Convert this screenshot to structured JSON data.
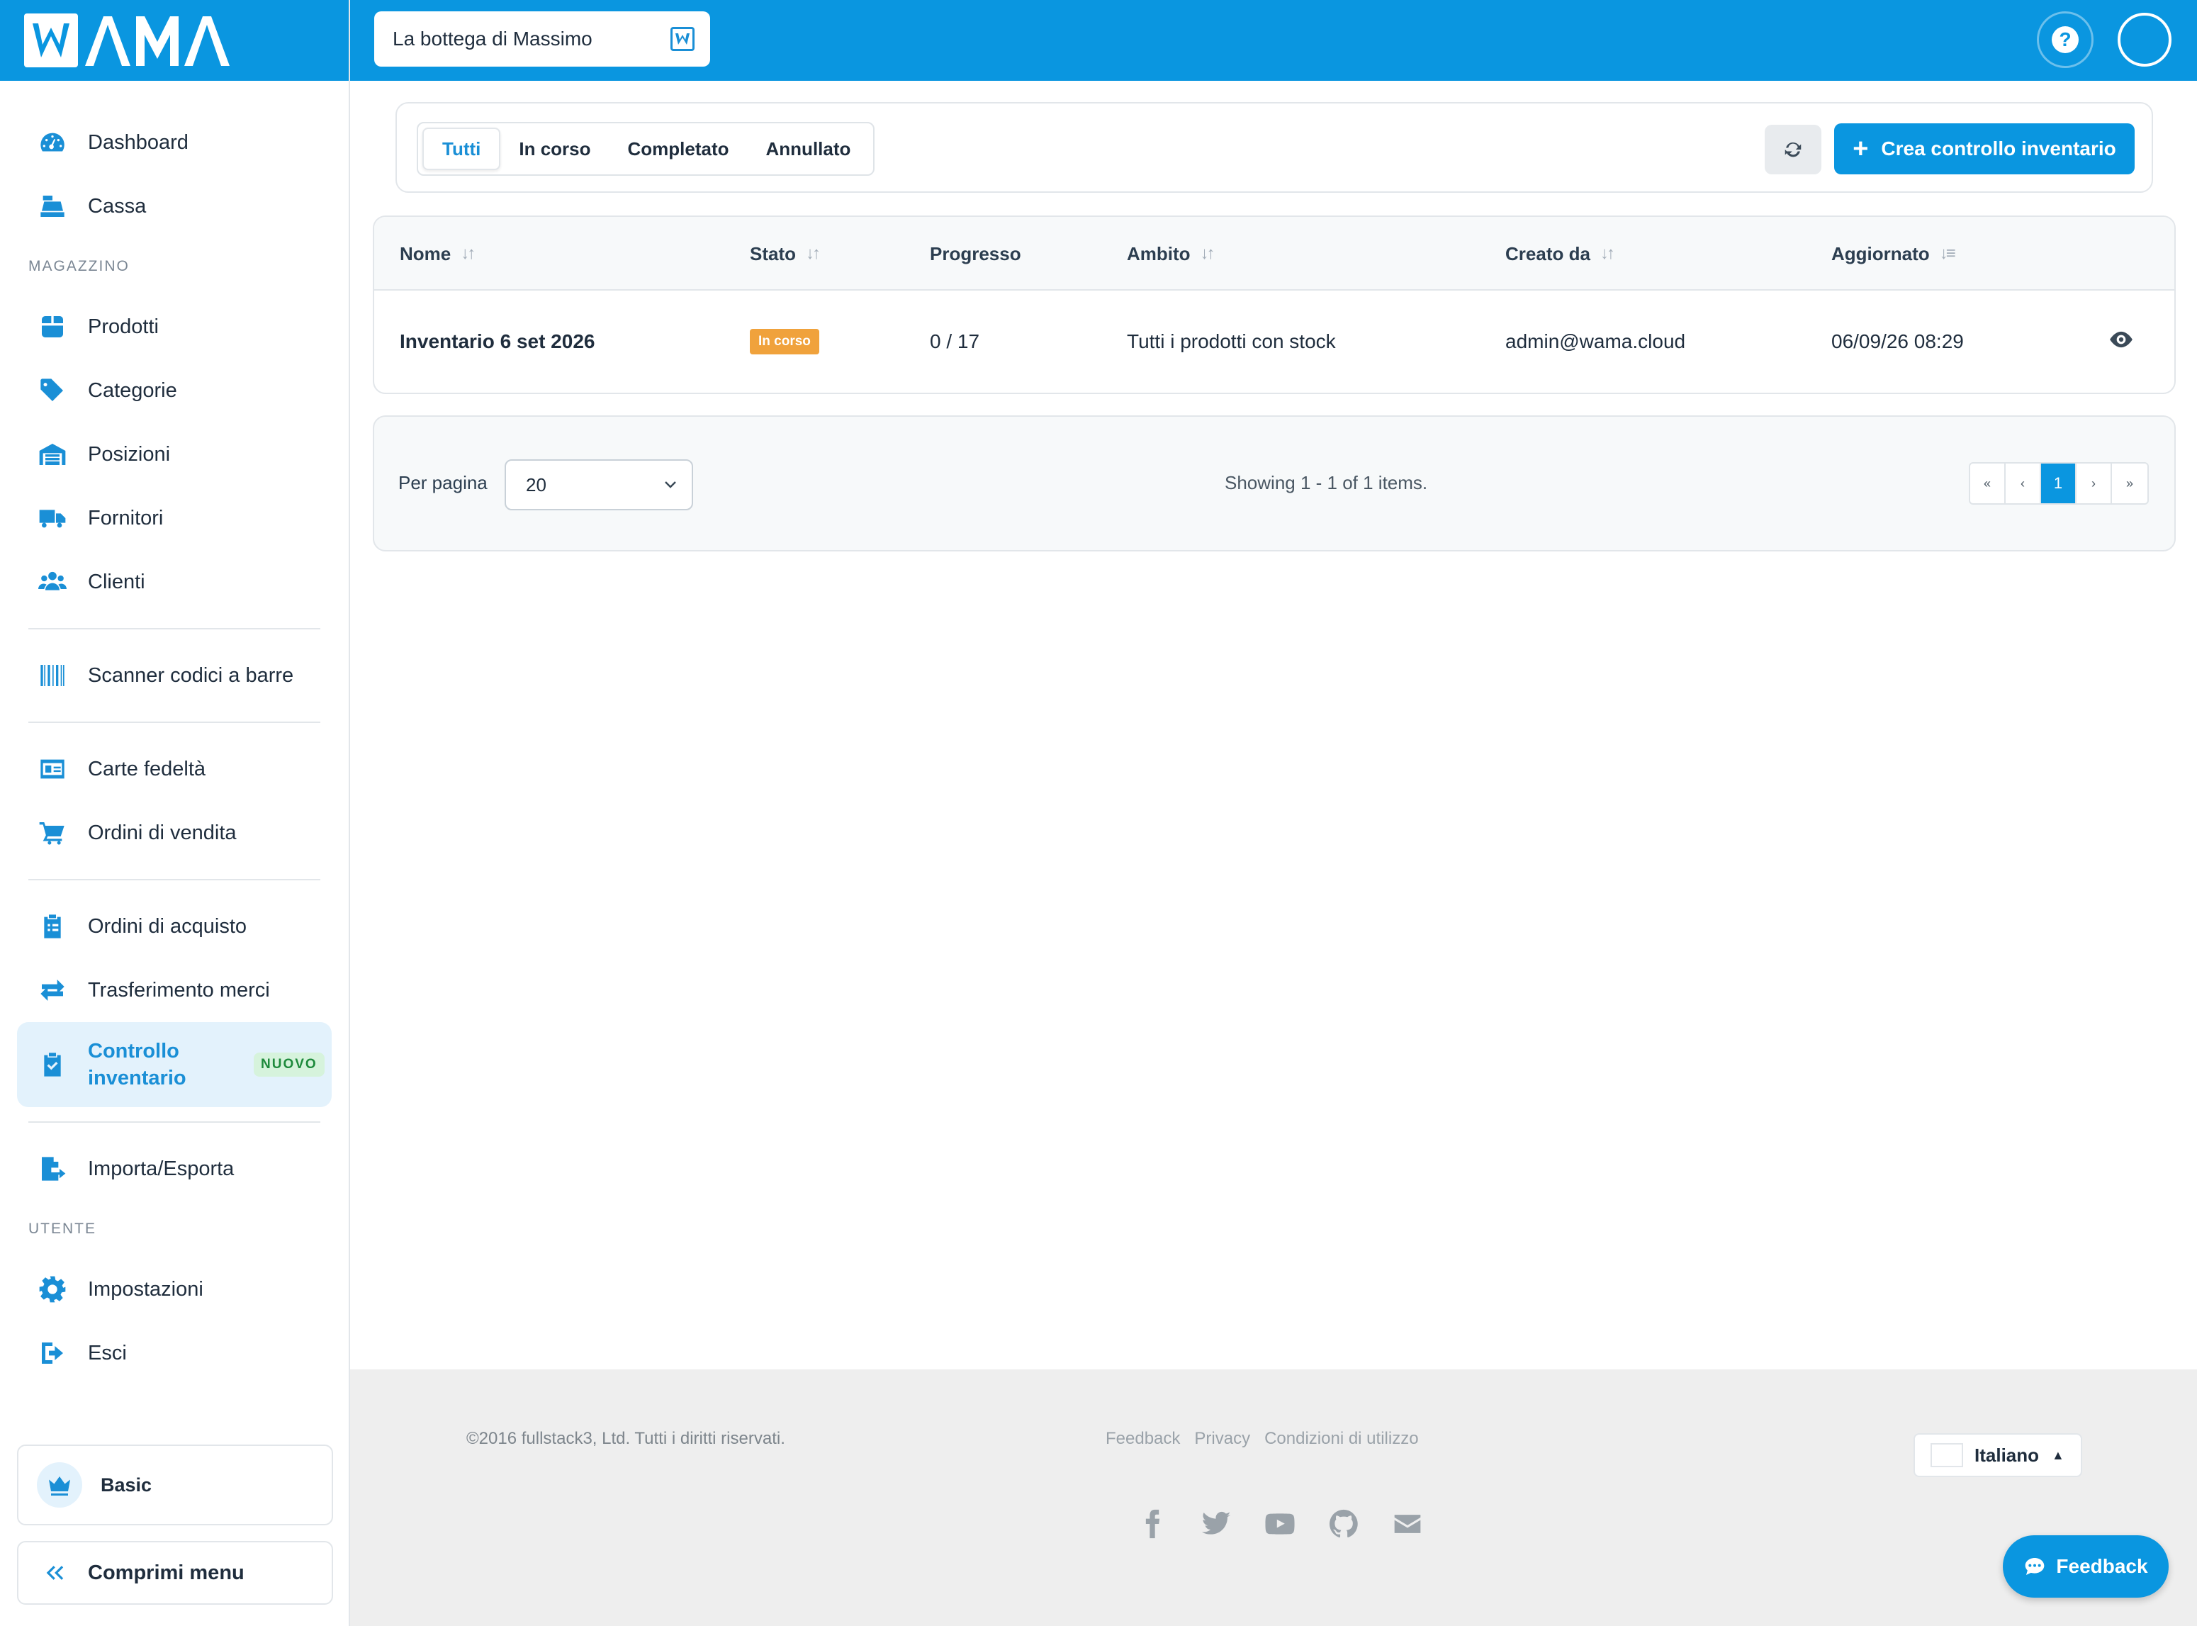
{
  "brand": {
    "logo_text": "WAMA"
  },
  "header": {
    "store_name": "La bottega di Massimo",
    "help_label": "?"
  },
  "sidebar": {
    "top_items": [
      {
        "label": "Dashboard",
        "icon": "dashboard-icon"
      },
      {
        "label": "Cassa",
        "icon": "cash-register-icon"
      }
    ],
    "section_warehouse": "MAGAZZINO",
    "warehouse_items": [
      {
        "label": "Prodotti",
        "icon": "box-icon"
      },
      {
        "label": "Categorie",
        "icon": "tags-icon"
      },
      {
        "label": "Posizioni",
        "icon": "warehouse-icon"
      },
      {
        "label": "Fornitori",
        "icon": "truck-icon"
      },
      {
        "label": "Clienti",
        "icon": "users-icon"
      }
    ],
    "scanner_label": "Scanner codici a barre",
    "loyalty_label": "Carte fedeltà",
    "sales_orders_label": "Ordini di vendita",
    "purchase_orders_label": "Ordini di acquisto",
    "transfer_label": "Trasferimento merci",
    "inventory_label": "Controllo inventario",
    "inventory_badge": "NUOVO",
    "import_export_label": "Importa/Esporta",
    "section_user": "UTENTE",
    "settings_label": "Impostazioni",
    "logout_label": "Esci",
    "plan_label": "Basic",
    "collapse_label": "Comprimi menu"
  },
  "filters": {
    "tabs": [
      "Tutti",
      "In corso",
      "Completato",
      "Annullato"
    ],
    "active_tab": "Tutti",
    "create_label": "Crea controllo inventario"
  },
  "table": {
    "headers": {
      "name": "Nome",
      "status": "Stato",
      "progress": "Progresso",
      "scope": "Ambito",
      "created_by": "Creato da",
      "updated": "Aggiornato"
    },
    "rows": [
      {
        "name": "Inventario 6 set 2026",
        "status": "In corso",
        "progress": "0 / 17",
        "scope": "Tutti i prodotti con stock",
        "created_by": "admin@wama.cloud",
        "updated": "06/09/26 08:29"
      }
    ]
  },
  "pager": {
    "per_page_label": "Per pagina",
    "per_page_value": "20",
    "showing": "Showing 1 - 1 of 1 items.",
    "first": "«",
    "prev": "‹",
    "current": "1",
    "next": "›",
    "last": "»"
  },
  "footer": {
    "copyright": "©2016 fullstack3, Ltd. Tutti i diritti riservati.",
    "links": [
      "Feedback",
      "Privacy",
      "Condizioni di utilizzo"
    ],
    "language": "Italiano",
    "socials": [
      "facebook-icon",
      "twitter-icon",
      "youtube-icon",
      "github-icon",
      "email-icon"
    ]
  },
  "feedback_button": "Feedback",
  "colors": {
    "primary": "#0a96e0",
    "status_in_progress": "#f0a23c",
    "new_badge": "#1e8a3c"
  }
}
